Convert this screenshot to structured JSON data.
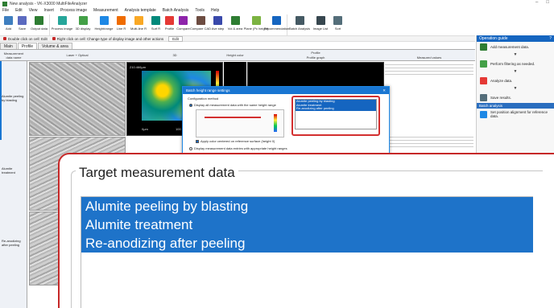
{
  "window": {
    "title": "New analysis - VK-X3000 MultiFileAnalyzer"
  },
  "menu": [
    "File",
    "Edit",
    "View",
    "Insert",
    "Process image",
    "Measurement",
    "Analysis template",
    "Batch Analysis",
    "Tools",
    "Help"
  ],
  "ribbon": [
    {
      "label": "Add",
      "color": "#3f7fbf",
      "icon": "add-icon"
    },
    {
      "label": "Save",
      "color": "#5c6bc0",
      "icon": "save-icon"
    },
    {
      "label": "Output data",
      "color": "#2e7d32",
      "icon": "output-icon"
    },
    {
      "label": "Process image",
      "color": "#26a69a",
      "icon": "process-image-icon"
    },
    {
      "label": "3D display",
      "color": "#43a047",
      "icon": "3d-icon"
    },
    {
      "label": "Height/range",
      "color": "#1e88e5",
      "icon": "height-range-icon"
    },
    {
      "label": "Line R",
      "color": "#ef6c00",
      "icon": "line-r-icon"
    },
    {
      "label": "Multi-line R",
      "color": "#f9a825",
      "icon": "multiline-icon"
    },
    {
      "label": "Surf R",
      "color": "#00897b",
      "icon": "surf-icon"
    },
    {
      "label": "Profile",
      "color": "#e53935",
      "icon": "profile-icon"
    },
    {
      "label": "Compare",
      "color": "#8e24aa",
      "icon": "compare-icon"
    },
    {
      "label": "Compare CAD",
      "color": "#6d4c41",
      "icon": "compare-cad-icon"
    },
    {
      "label": "Ave step",
      "color": "#3949ab",
      "icon": "ave-step-icon"
    },
    {
      "label": "Vol & area",
      "color": "#2e7d32",
      "icon": "vol-area-icon"
    },
    {
      "label": "Plane (Pc height)",
      "color": "#7cb342",
      "icon": "plane-icon"
    },
    {
      "label": "Recommendation",
      "color": "#1565c0",
      "icon": "recommendation-icon"
    },
    {
      "label": "Batch Analysis",
      "color": "#455a64",
      "icon": "batch-icon"
    },
    {
      "label": "Image List",
      "color": "#37474f",
      "icon": "image-list-icon"
    },
    {
      "label": "Sort",
      "color": "#546e7a",
      "icon": "sort-icon"
    }
  ],
  "hintbar": {
    "hint1": "Double click on cell: Edit",
    "hint2": "Right click on cell: Change type of display image and other actions",
    "edit": "Edit"
  },
  "tabs": [
    "Main",
    "Profile",
    "Volume & area"
  ],
  "grid": {
    "headers": {
      "name": "Measurement data name",
      "laser": "Laser + Optical",
      "view3d": "3D",
      "height": "Height color",
      "profile": "Profile",
      "profile_graph": "Profile graph",
      "measured": "Measured values"
    },
    "rows": [
      "Alumite peeling by blasting",
      "Alumite treatment",
      "Re-anodizing after peeling"
    ],
    "heat_caption_top": "210.466μm",
    "heat_caption_bottom": "0μm",
    "heat_caption_right": "100"
  },
  "dialog": {
    "title": "Batch height range settings",
    "section": "Configuration method",
    "option1": "Display all measurement data with the same height range",
    "option2": "Display measurement data entries with appropriate height ranges",
    "checkbox": "Apply color centered on reference surface (height 0)",
    "list": [
      "Alumite peeling by blasting",
      "Alumite treatment",
      "Re-anodizing after peeling"
    ]
  },
  "sidepanel": {
    "guide_title": "Operation guide",
    "guide_items": [
      "Add measurement data.",
      "Perform filtering as needed.",
      "Analyze data.",
      "Save results."
    ],
    "batch_title": "Batch analysis",
    "batch_item": "Set position alignment for reference data."
  },
  "zoom": {
    "legend": "Target measurement data",
    "items": [
      "Alumite peeling by blasting",
      "Alumite treatment",
      "Re-anodizing after peeling"
    ]
  }
}
